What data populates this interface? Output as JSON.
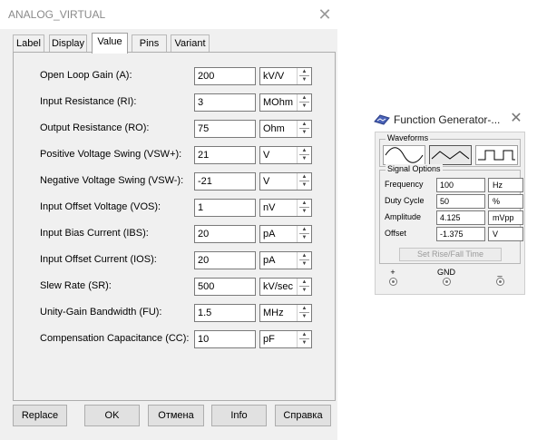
{
  "dialog": {
    "title": "ANALOG_VIRTUAL",
    "close": "✕",
    "tabs": [
      "Label",
      "Display",
      "Value",
      "Pins",
      "Variant"
    ],
    "active_tab": "Value",
    "rows": [
      {
        "label": "Open Loop Gain (A):",
        "value": "200",
        "unit": "kV/V"
      },
      {
        "label": "Input Resistance (RI):",
        "value": "3",
        "unit": "MOhm"
      },
      {
        "label": "Output Resistance (RO):",
        "value": "75",
        "unit": "Ohm"
      },
      {
        "label": "Positive Voltage Swing (VSW+):",
        "value": "21",
        "unit": "V"
      },
      {
        "label": "Negative Voltage Swing (VSW-):",
        "value": "-21",
        "unit": "V"
      },
      {
        "label": "Input Offset Voltage (VOS):",
        "value": "1",
        "unit": "nV"
      },
      {
        "label": "Input Bias Current (IBS):",
        "value": "20",
        "unit": "pA"
      },
      {
        "label": "Input Offset Current (IOS):",
        "value": "20",
        "unit": "pA"
      },
      {
        "label": "Slew Rate (SR):",
        "value": "500",
        "unit": "kV/sec"
      },
      {
        "label": "Unity-Gain Bandwidth (FU):",
        "value": "1.5",
        "unit": "MHz"
      },
      {
        "label": "Compensation Capacitance (CC):",
        "value": "10",
        "unit": "pF"
      }
    ],
    "buttons": {
      "replace": "Replace",
      "ok": "OK",
      "cancel": "Отмена",
      "info": "Info",
      "help": "Справка"
    }
  },
  "function_generator": {
    "title": "Function Generator-...",
    "close": "✕",
    "waveforms_caption": "Waveforms",
    "selected_waveform": "triangle",
    "signal_options_caption": "Signal Options",
    "rows": [
      {
        "label": "Frequency",
        "value": "100",
        "unit": "Hz"
      },
      {
        "label": "Duty Cycle",
        "value": "50",
        "unit": "%"
      },
      {
        "label": "Amplitude",
        "value": "4.125",
        "unit": "mVpp"
      },
      {
        "label": "Offset",
        "value": "-1.375",
        "unit": "V"
      }
    ],
    "rise_fall_button": "Set Rise/Fall Time",
    "terminals": {
      "plus": "+",
      "gnd": "GND",
      "minus": "_"
    }
  }
}
